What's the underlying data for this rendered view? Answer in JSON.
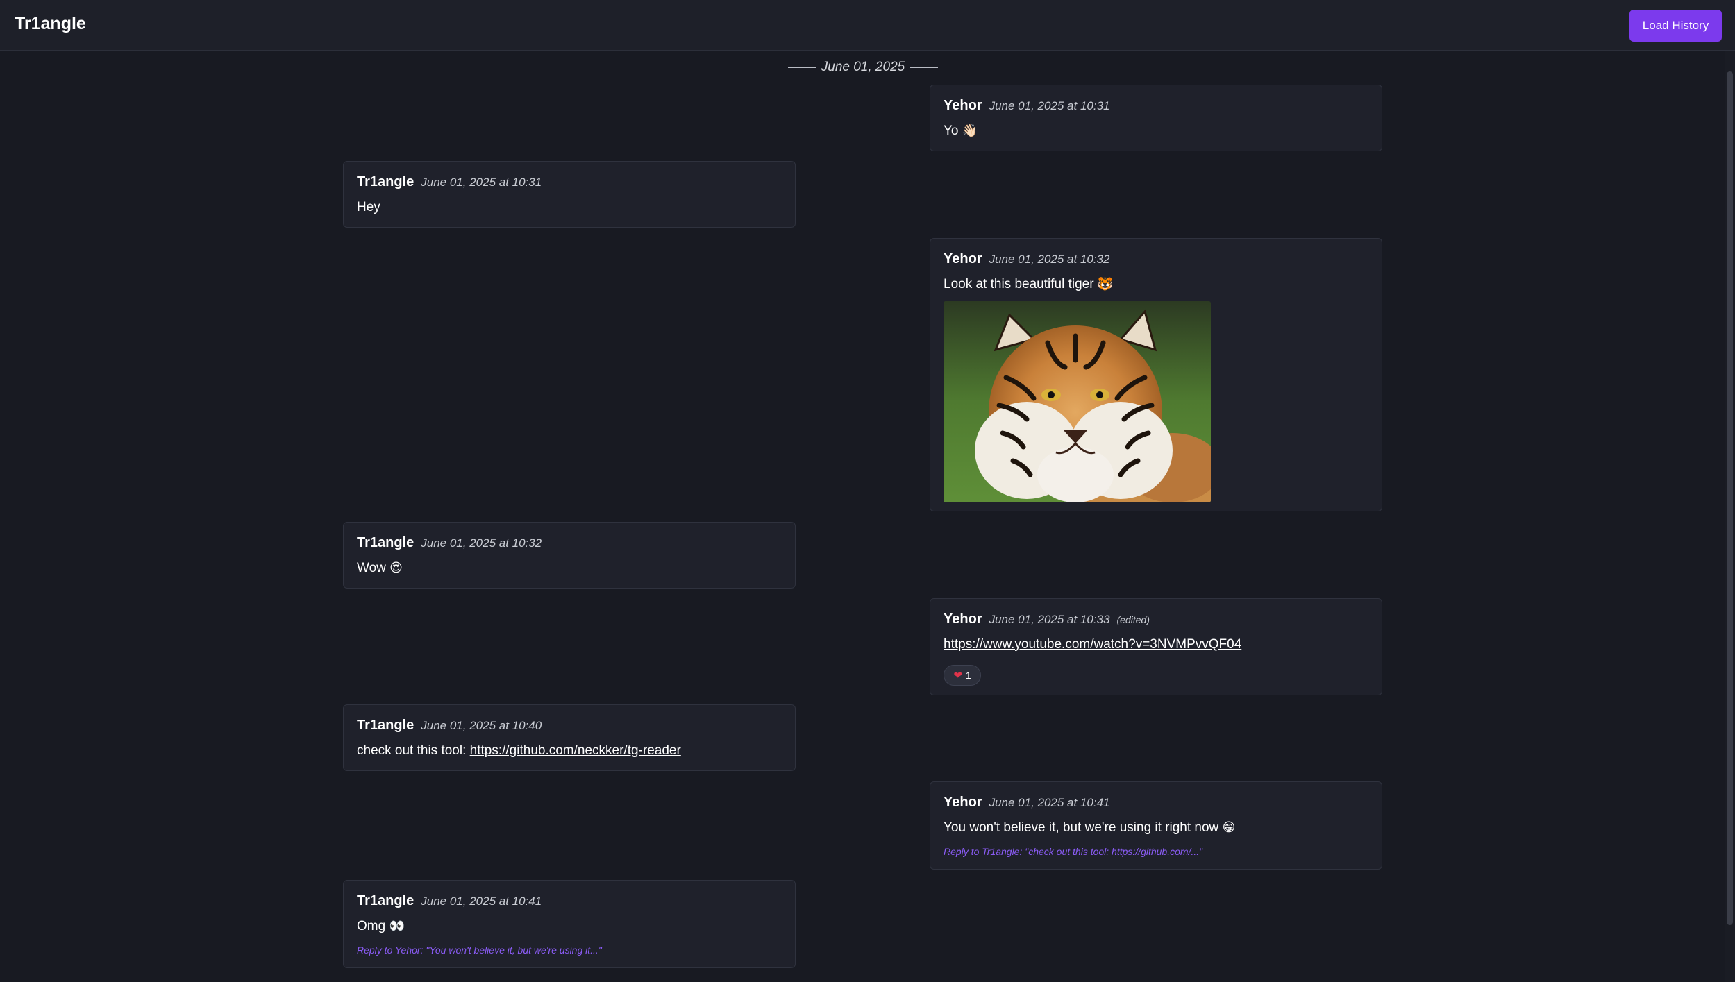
{
  "app": {
    "title": "Tr1angle",
    "load_history_label": "Load History"
  },
  "date_separator": "June 01, 2025",
  "messages": [
    {
      "author": "Yehor",
      "time": "June 01, 2025 at 10:31",
      "text": "Yo",
      "emoji": "👋🏻"
    },
    {
      "author": "Tr1angle",
      "time": "June 01, 2025 at 10:31",
      "text": "Hey"
    },
    {
      "author": "Yehor",
      "time": "June 01, 2025 at 10:32",
      "text": "Look at this beautiful tiger",
      "emoji": "🐯",
      "image": "tiger photo"
    },
    {
      "author": "Tr1angle",
      "time": "June 01, 2025 at 10:32",
      "text": "Wow",
      "emoji": "😍"
    },
    {
      "author": "Yehor",
      "time": "June 01, 2025 at 10:33",
      "edited": "(edited)",
      "link": "https://www.youtube.com/watch?v=3NVMPvvQF04",
      "reaction": {
        "emoji": "❤",
        "count": "1"
      }
    },
    {
      "author": "Tr1angle",
      "time": "June 01, 2025 at 10:40",
      "text": "check out this tool:",
      "link": "https://github.com/neckker/tg-reader"
    },
    {
      "author": "Yehor",
      "time": "June 01, 2025 at 10:41",
      "text": "You won't believe it, but we're using it right now",
      "emoji": "😁",
      "reply": "Reply to Tr1angle: \"check out this tool: https://github.com/...\""
    },
    {
      "author": "Tr1angle",
      "time": "June 01, 2025 at 10:41",
      "text": "Omg",
      "emoji": "👀",
      "reply": "Reply to Yehor: \"You won't believe it, but we're using it...\""
    }
  ],
  "colors": {
    "accent": "#7c3aed",
    "reply": "#8b5cf6",
    "background": "#181a22",
    "card": "#1f212b"
  }
}
